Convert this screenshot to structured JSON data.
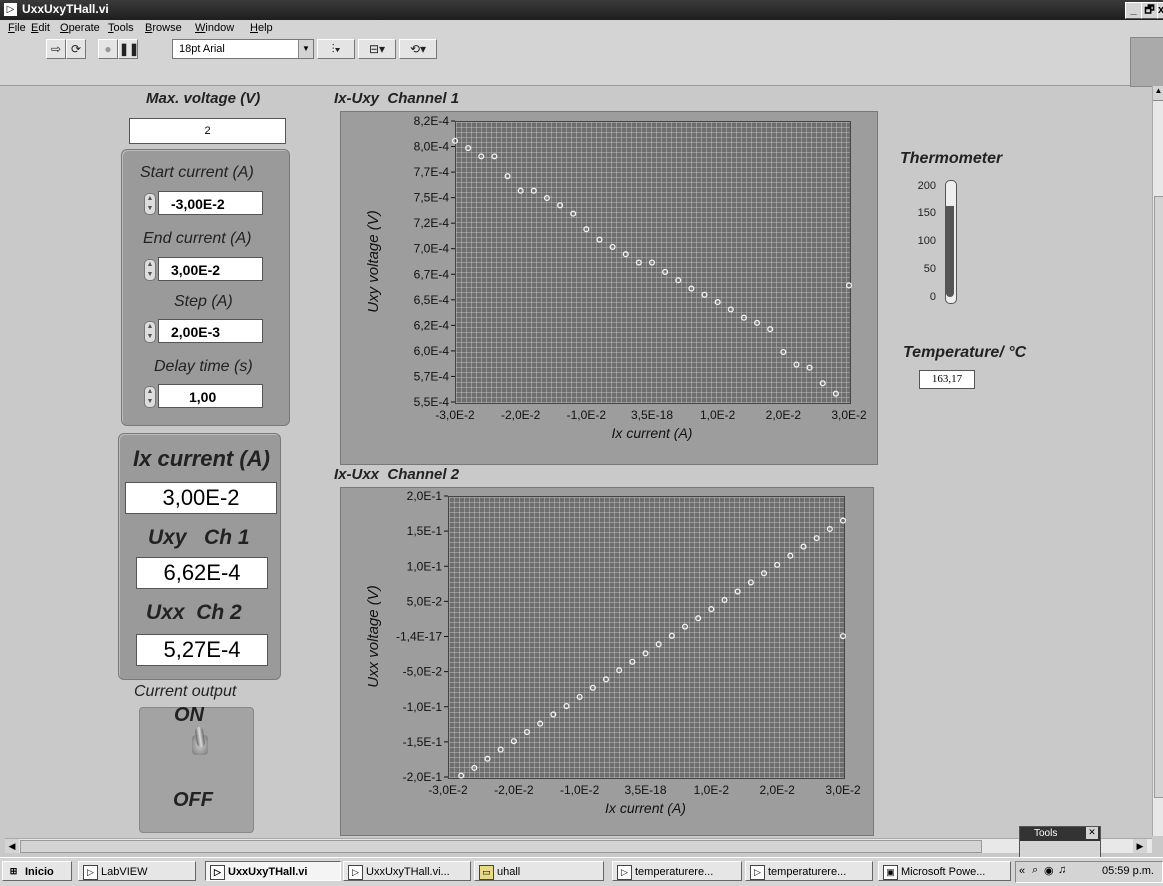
{
  "window": {
    "title": "UxxUxyTHall.vi",
    "min": "_",
    "max": "🗗",
    "close": "x"
  },
  "menu": {
    "items": [
      "File",
      "Edit",
      "Operate",
      "Tools",
      "Browse",
      "Window",
      "Help"
    ]
  },
  "toolbar": {
    "font": "18pt Arial",
    "run_icon": "run-arrow-icon",
    "run_cont_icon": "run-continuously-icon",
    "abort_icon": "abort-icon",
    "pause_icon": "pause-icon"
  },
  "controls": {
    "max_voltage": {
      "label": "Max. voltage (V)",
      "value": "2"
    },
    "start_current": {
      "label": "Start current (A)",
      "value": "-3,00E-2"
    },
    "end_current": {
      "label": "End current (A)",
      "value": "3,00E-2"
    },
    "step": {
      "label": "Step (A)",
      "value": "2,00E-3"
    },
    "delay": {
      "label": "Delay time (s)",
      "value": "1,00"
    }
  },
  "indicators": {
    "ix": {
      "label": "Ix current (A)",
      "value": "3,00E-2"
    },
    "uxy": {
      "label": "Uxy   Ch 1",
      "value": "6,62E-4"
    },
    "uxx": {
      "label": "Uxx  Ch 2",
      "value": "5,27E-4"
    }
  },
  "current_output": {
    "label": "Current output",
    "on": "ON",
    "off": "OFF",
    "state": "on"
  },
  "thermometer": {
    "label": "Thermometer",
    "ticks": [
      "200",
      "150",
      "100",
      "50",
      "0"
    ],
    "value": 163.17,
    "max": 200
  },
  "temperature": {
    "label": "Temperature/ °C",
    "value": "163,17"
  },
  "chart_data": [
    {
      "type": "scatter",
      "title": "Ix-Uxy  Channel 1",
      "xlabel": "Ix current (A)",
      "ylabel": "Uxy voltage (V)",
      "xlim": [
        -0.03,
        0.03
      ],
      "ylim": [
        0.00055,
        0.00082
      ],
      "x_ticks": [
        "-3,0E-2",
        "-2,0E-2",
        "-1,0E-2",
        "3,5E-18",
        "1,0E-2",
        "2,0E-2",
        "3,0E-2"
      ],
      "y_ticks": [
        "8,2E-4",
        "8,0E-4",
        "7,7E-4",
        "7,5E-4",
        "7,2E-4",
        "7,0E-4",
        "6,7E-4",
        "6,5E-4",
        "6,2E-4",
        "6,0E-4",
        "5,7E-4",
        "5,5E-4"
      ],
      "grid": true,
      "x": [
        -0.03,
        -0.028,
        -0.026,
        -0.024,
        -0.022,
        -0.02,
        -0.018,
        -0.016,
        -0.014,
        -0.012,
        -0.01,
        -0.008,
        -0.006,
        -0.004,
        -0.002,
        0.0,
        0.002,
        0.004,
        0.006,
        0.008,
        0.01,
        0.012,
        0.014,
        0.016,
        0.018,
        0.02,
        0.022,
        0.024,
        0.026,
        0.028,
        0.03
      ],
      "y": [
        0.000801,
        0.000794,
        0.000786,
        0.000786,
        0.000767,
        0.000753,
        0.000753,
        0.000746,
        0.000739,
        0.000731,
        0.000716,
        0.000706,
        0.000699,
        0.000692,
        0.000684,
        0.000684,
        0.000675,
        0.000667,
        0.000659,
        0.000653,
        0.000646,
        0.000639,
        0.000631,
        0.000626,
        0.00062,
        0.000598,
        0.000586,
        0.000583,
        0.000568,
        0.000558,
        0.000662
      ]
    },
    {
      "type": "scatter",
      "title": "Ix-Uxx  Channel 2",
      "xlabel": "Ix current (A)",
      "ylabel": "Uxx voltage (V)",
      "xlim": [
        -0.03,
        0.03
      ],
      "ylim": [
        -0.2,
        0.2
      ],
      "x_ticks": [
        "-3,0E-2",
        "-2,0E-2",
        "-1,0E-2",
        "3,5E-18",
        "1,0E-2",
        "2,0E-2",
        "3,0E-2"
      ],
      "y_ticks": [
        "2,0E-1",
        "1,5E-1",
        "1,0E-1",
        "5,0E-2",
        "-1,4E-17",
        "-5,0E-2",
        "-1,0E-1",
        "-1,5E-1",
        "-2,0E-1"
      ],
      "grid": true,
      "x": [
        -0.028,
        -0.026,
        -0.024,
        -0.022,
        -0.02,
        -0.018,
        -0.016,
        -0.014,
        -0.012,
        -0.01,
        -0.008,
        -0.006,
        -0.004,
        -0.002,
        0.0,
        0.002,
        0.004,
        0.006,
        0.008,
        0.01,
        0.012,
        0.014,
        0.016,
        0.018,
        0.02,
        0.022,
        0.024,
        0.026,
        0.028,
        0.03
      ],
      "y": [
        -0.198,
        -0.187,
        -0.174,
        -0.161,
        -0.149,
        -0.136,
        -0.124,
        -0.111,
        -0.099,
        -0.086,
        -0.073,
        -0.061,
        -0.048,
        -0.036,
        -0.024,
        -0.011,
        0.001,
        0.014,
        0.026,
        0.039,
        0.052,
        0.064,
        0.077,
        0.09,
        0.102,
        0.115,
        0.128,
        0.14,
        0.153,
        0.165
      ]
    }
  ],
  "extra_point": {
    "ch2_x": 0.03,
    "ch2_y": 0.0005
  },
  "taskbar": {
    "start": "Inicio",
    "buttons": [
      "LabVIEW",
      "UxxUxyTHall.vi",
      "UxxUxyTHall.vi...",
      "uhall",
      "temperaturere...",
      "temperaturere...",
      "Microsoft Powe..."
    ],
    "clock": "05:59 p.m."
  },
  "tools_palette": {
    "title": "Tools"
  }
}
